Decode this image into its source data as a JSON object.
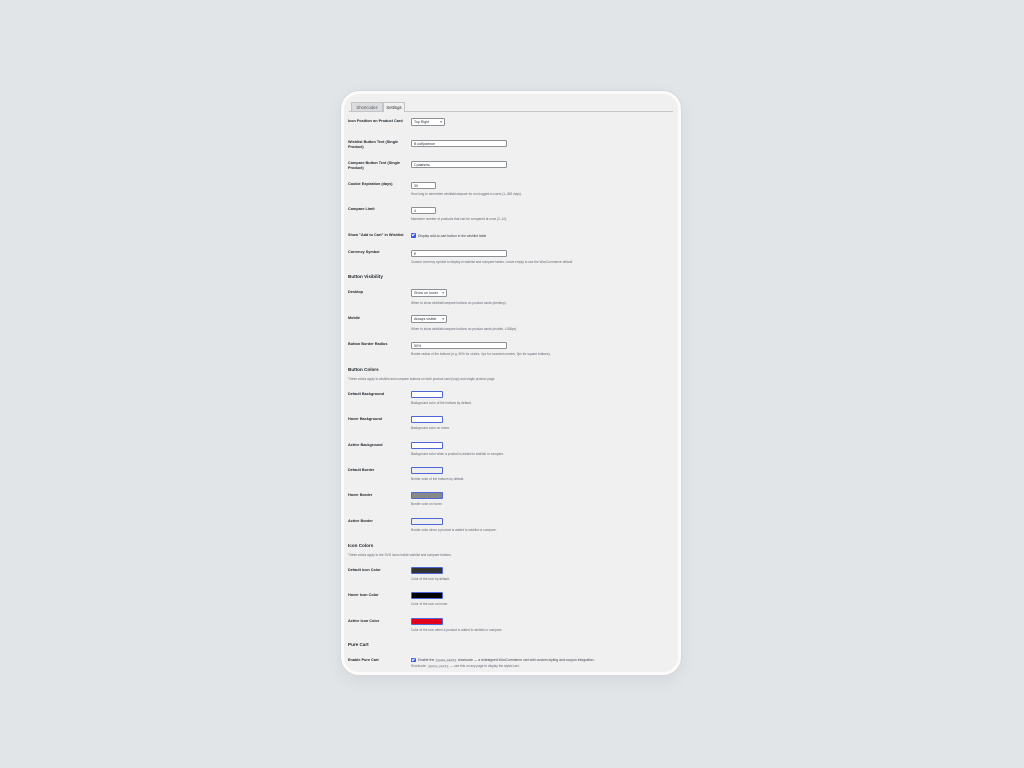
{
  "tabs": [
    {
      "label": "Shortcodes",
      "active": false
    },
    {
      "label": "Settings",
      "active": true
    }
  ],
  "icon_position": {
    "label": "Icon Position on Product Card",
    "value": "Top Right"
  },
  "wishlist_text": {
    "label": "Wishlist Button Text (Single Product)",
    "value": "В избранное"
  },
  "compare_text": {
    "label": "Compare Button Text (Single Product)",
    "value": "Сравнить"
  },
  "cookie": {
    "label": "Cookie Expiration (days)",
    "value": "30",
    "desc": "How long to remember wishlist/compare for non-logged-in users (1–365 days)."
  },
  "compare_limit": {
    "label": "Compare Limit",
    "value": "4",
    "desc": "Maximum number of products that can be compared at once (2–10)."
  },
  "show_add_to_cart": {
    "label": "Show \"Add to Cart\" in Wishlist",
    "checked": true,
    "checkbox_label": "Display add-to-cart button in the wishlist table"
  },
  "currency": {
    "label": "Currency Symbol",
    "value": "₽",
    "desc": "Custom currency symbol to display in wishlist and compare tables. Leave empty to use the WooCommerce default."
  },
  "visibility": {
    "title": "Button Visibility",
    "desktop": {
      "label": "Desktop",
      "value": "Show on hover",
      "desc": "When to show wishlist/compare buttons on product cards (desktop)."
    },
    "mobile": {
      "label": "Mobile",
      "value": "Always visible",
      "desc": "When to show wishlist/compare buttons on product cards (mobile, ≤768px)."
    },
    "radius": {
      "label": "Button Border Radius",
      "value": "50%",
      "desc": "Border radius of the buttons (e.g. 50% for circles, 4px for rounded corners, 0px for square buttons)."
    }
  },
  "button_colors": {
    "title": "Button Colors",
    "desc": "These colors apply to wishlist and compare buttons on both product card (loop) and single product page.",
    "items": [
      {
        "key": "default-background",
        "label": "Default Background",
        "color": "#ffffff",
        "desc": "Background color of the buttons by default."
      },
      {
        "key": "hover-background",
        "label": "Hover Background",
        "color": "#ffffff",
        "desc": "Background color on hover."
      },
      {
        "key": "active-background",
        "label": "Active Background",
        "color": "#ffffff",
        "desc": "Background color when a product is added to wishlist or compare."
      },
      {
        "key": "default-border",
        "label": "Default Border",
        "color": "#eeeeee",
        "desc": "Border color of the buttons by default."
      },
      {
        "key": "hover-border",
        "label": "Hover Border",
        "color": "#888888",
        "desc": "Border color on hover."
      },
      {
        "key": "active-border",
        "label": "Active Border",
        "color": "#eeeeee",
        "desc": "Border color when a product is added to wishlist or compare."
      }
    ]
  },
  "icon_colors": {
    "title": "Icon Colors",
    "desc": "These colors apply to the SVG icons inside wishlist and compare buttons.",
    "items": [
      {
        "key": "default-icon",
        "label": "Default Icon Color",
        "color": "#333333",
        "desc": "Color of the icon by default."
      },
      {
        "key": "hover-icon",
        "label": "Hover Icon Color",
        "color": "#000000",
        "desc": "Color of the icon on hover."
      },
      {
        "key": "active-icon",
        "label": "Active Icon Color",
        "color": "#e2001a",
        "desc": "Color of the icon when a product is added to wishlist or compare."
      }
    ]
  },
  "pure_cart": {
    "title": "Pure Cart",
    "label": "Enable Pure Cart",
    "checked": true,
    "text_before": "Enable the",
    "code": "[pure_cart]",
    "text_after": "shortcode — a redesigned WooCommerce cart with custom styling and coupon integration.",
    "line2_before": "Shortcode:",
    "line2_code": "[pure_cart]",
    "line2_after": "— use this on any page to display the styled cart."
  }
}
